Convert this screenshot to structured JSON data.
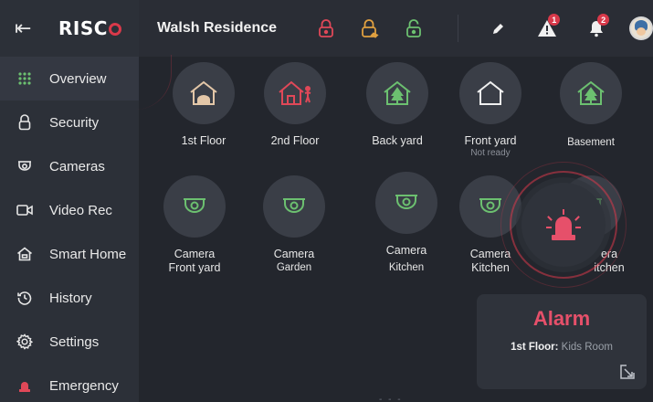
{
  "brand": {
    "logo_text": "RISC",
    "accent": "#d9394a",
    "active_nav": "#6cc070"
  },
  "header": {
    "site_name": "Walsh Residence",
    "locks": [
      {
        "icon": "lock-closed-icon",
        "color": "#e04858"
      },
      {
        "icon": "lock-partial-icon",
        "color": "#e0a040"
      },
      {
        "icon": "lock-open-icon",
        "color": "#6cc070"
      }
    ],
    "alerts_badge": "1",
    "notifications_badge": "2"
  },
  "sidebar": {
    "items": [
      {
        "label": "Overview",
        "icon": "grid-icon",
        "active": true
      },
      {
        "label": "Security",
        "icon": "lock-icon"
      },
      {
        "label": "Cameras",
        "icon": "camera-icon"
      },
      {
        "label": "Video Rec",
        "icon": "video-icon"
      },
      {
        "label": "Smart Home",
        "icon": "smart-home-icon"
      },
      {
        "label": "History",
        "icon": "history-icon"
      },
      {
        "label": "Settings",
        "icon": "gear-icon"
      },
      {
        "label": "Emergency",
        "icon": "siren-icon"
      }
    ]
  },
  "tiles": {
    "row1": [
      {
        "label": "1st Floor",
        "icon": "house-occupied-icon"
      },
      {
        "label": "2nd Floor",
        "icon": "house-person-icon"
      },
      {
        "label": "Back yard",
        "icon": "house-tree-icon"
      },
      {
        "label": "Front yard",
        "sub": "Not ready",
        "icon": "house-outline-icon"
      },
      {
        "label": "Basement",
        "icon": "house-tree-icon"
      }
    ],
    "row2": [
      {
        "label": "Camera",
        "label2": "Front yard",
        "icon": "dome-camera-icon"
      },
      {
        "label": "Camera",
        "label2": "Garden",
        "icon": "dome-camera-icon"
      },
      {
        "label": "Camera",
        "label2": "Kitchen",
        "icon": "dome-camera-icon"
      },
      {
        "label": "Camera",
        "label2": "Kitchen",
        "icon": "dome-camera-icon"
      },
      {
        "label": "era",
        "label2": "itchen",
        "icon": "dome-camera-icon"
      }
    ]
  },
  "alarm": {
    "title": "Alarm",
    "location_label": "1st Floor:",
    "location_value": "Kids Room",
    "color": "#e6506a"
  },
  "pager": "- - -"
}
